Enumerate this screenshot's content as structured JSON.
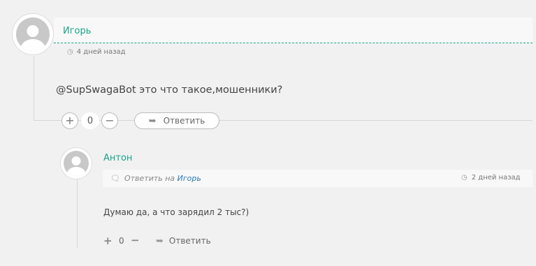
{
  "comment": {
    "author": "Игорь",
    "date": "4 дней назад",
    "text": "@SupSwagaBot это что такое,мошенники?",
    "vote_count": "0",
    "reply_label": "Ответить",
    "icons": {
      "clock": "clock-icon",
      "plus": "plus-icon",
      "minus": "minus-icon",
      "reply": "reply-arrow-icon"
    }
  },
  "reply": {
    "author": "Антон",
    "reply_to_label": "Ответить на",
    "reply_to_user": "Игорь",
    "date": "2 дней назад",
    "text": "Думаю да, а что зарядил 2 тыс?)",
    "vote_count": "0",
    "reply_label": "Ответить",
    "icons": {
      "comment": "comment-icon",
      "clock": "clock-icon",
      "plus": "plus-icon",
      "minus": "minus-icon",
      "reply": "reply-arrow-icon"
    }
  },
  "colors": {
    "accent": "#1aa488",
    "link": "#2a78b8",
    "background": "#f1f1f1"
  }
}
